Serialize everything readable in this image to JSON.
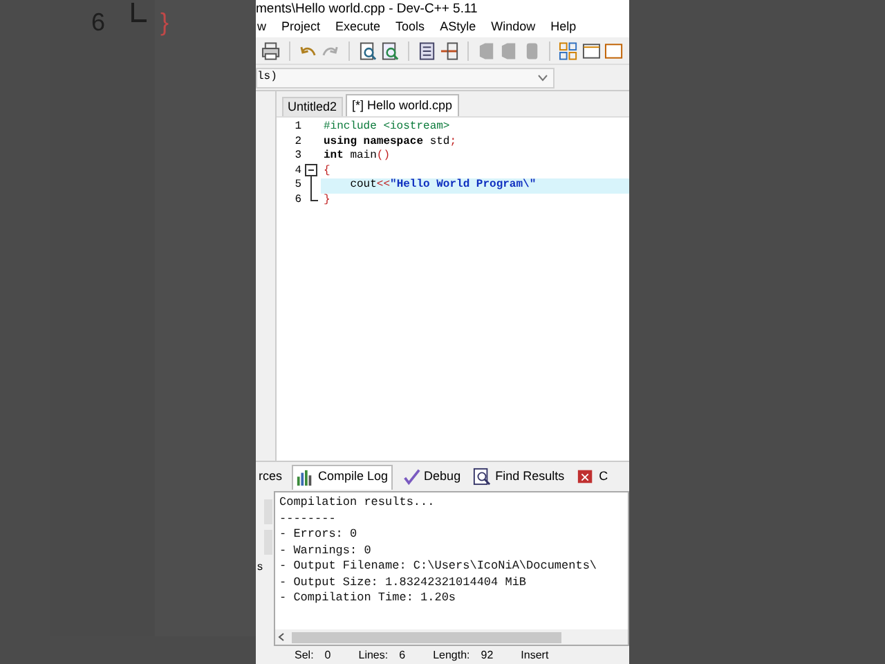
{
  "background": {
    "line_number": "6",
    "brace": "}"
  },
  "window": {
    "title": "ments\\Hello world.cpp - Dev-C++ 5.11"
  },
  "menu": [
    "w",
    "Project",
    "Execute",
    "Tools",
    "AStyle",
    "Window",
    "Help"
  ],
  "scope_dropdown": {
    "value": "ls)"
  },
  "tabs": [
    {
      "label": "Untitled2",
      "selected": false
    },
    {
      "label": "[*] Hello world.cpp",
      "selected": true
    }
  ],
  "editor": {
    "lines": [
      {
        "number": "1",
        "fold_start": false,
        "fold_end": false,
        "current": false,
        "tokens": [
          {
            "kind": "preprocessor",
            "text": "#include <iostream>"
          }
        ]
      },
      {
        "number": "2",
        "fold_start": false,
        "fold_end": false,
        "current": false,
        "tokens": [
          {
            "kind": "keyword",
            "text": "using namespace "
          },
          {
            "kind": "plain",
            "text": "std"
          },
          {
            "kind": "symbol",
            "text": ";"
          }
        ]
      },
      {
        "number": "3",
        "fold_start": false,
        "fold_end": false,
        "current": false,
        "tokens": [
          {
            "kind": "keyword",
            "text": "int "
          },
          {
            "kind": "plain",
            "text": "main"
          },
          {
            "kind": "symbol",
            "text": "()"
          }
        ]
      },
      {
        "number": "4",
        "fold_start": true,
        "fold_end": false,
        "current": false,
        "tokens": [
          {
            "kind": "symbol",
            "text": "{"
          }
        ]
      },
      {
        "number": "5",
        "fold_start": false,
        "fold_end": false,
        "current": true,
        "tokens": [
          {
            "kind": "plain",
            "text": "    cout"
          },
          {
            "kind": "symbol",
            "text": "<<"
          },
          {
            "kind": "string",
            "text": "\"Hello World Program\\\""
          }
        ]
      },
      {
        "number": "6",
        "fold_start": false,
        "fold_end": true,
        "current": false,
        "tokens": [
          {
            "kind": "symbol",
            "text": "}"
          }
        ]
      }
    ]
  },
  "bottom_tabs": [
    {
      "label": "rces",
      "selected": false,
      "icon": false
    },
    {
      "label": "Compile Log",
      "selected": true,
      "icon": true
    },
    {
      "label": "Debug",
      "selected": false,
      "icon": true
    },
    {
      "label": "Find Results",
      "selected": false,
      "icon": true
    },
    {
      "label": "C",
      "selected": false,
      "icon": true
    }
  ],
  "side_label": "s",
  "compile_log": [
    "Compilation results...",
    "--------",
    "- Errors: 0",
    "- Warnings: 0",
    "- Output Filename: C:\\Users\\IcoNiA\\Documents\\",
    "- Output Size: 1.83242321014404 MiB",
    "- Compilation Time: 1.20s"
  ],
  "status_bar": [
    {
      "label": "Sel:",
      "value": "0"
    },
    {
      "label": "Lines:",
      "value": "6"
    },
    {
      "label": "Length:",
      "value": "92"
    },
    {
      "value": "Insert"
    }
  ]
}
